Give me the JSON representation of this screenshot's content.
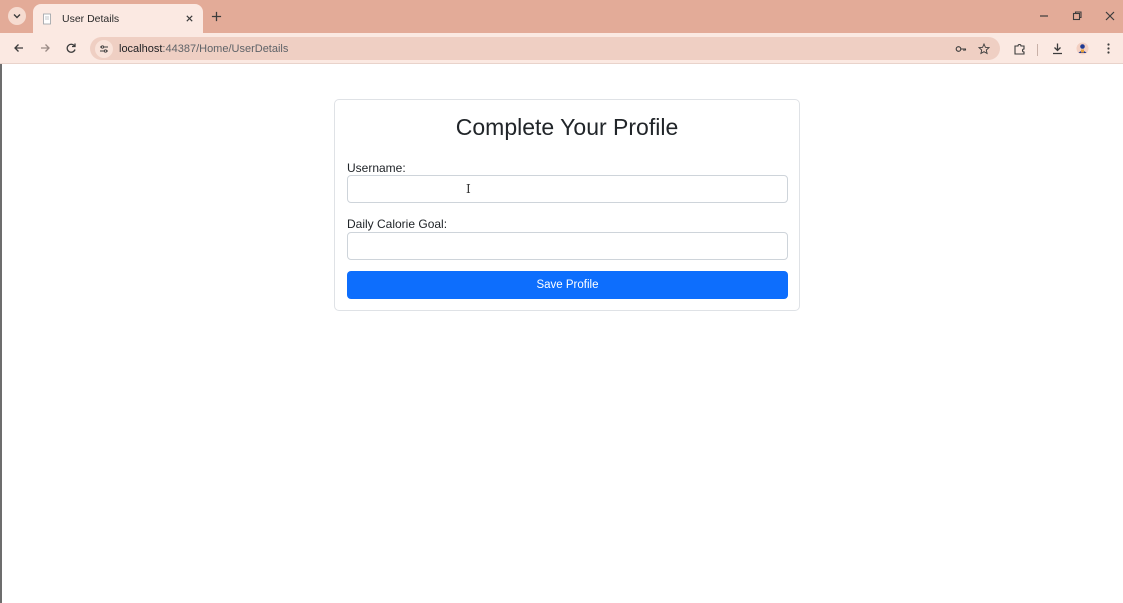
{
  "browser": {
    "tab": {
      "title": "User Details",
      "favicon": "document-icon"
    },
    "address_bar": {
      "host": "localhost",
      "path": ":44387/Home/UserDetails"
    },
    "colors": {
      "chrome_frame": "#e3ab98",
      "chrome_toolbar": "#fbe9e2",
      "omnibox": "#efcfc3"
    }
  },
  "page": {
    "title": "Complete Your Profile",
    "fields": [
      {
        "label": "Username:",
        "value": "",
        "cursor": "I"
      },
      {
        "label": "Daily Calorie Goal:",
        "value": ""
      }
    ],
    "submit_label": "Save Profile",
    "colors": {
      "primary": "#0d6efd",
      "text": "#212529",
      "border": "#ced4da"
    }
  }
}
